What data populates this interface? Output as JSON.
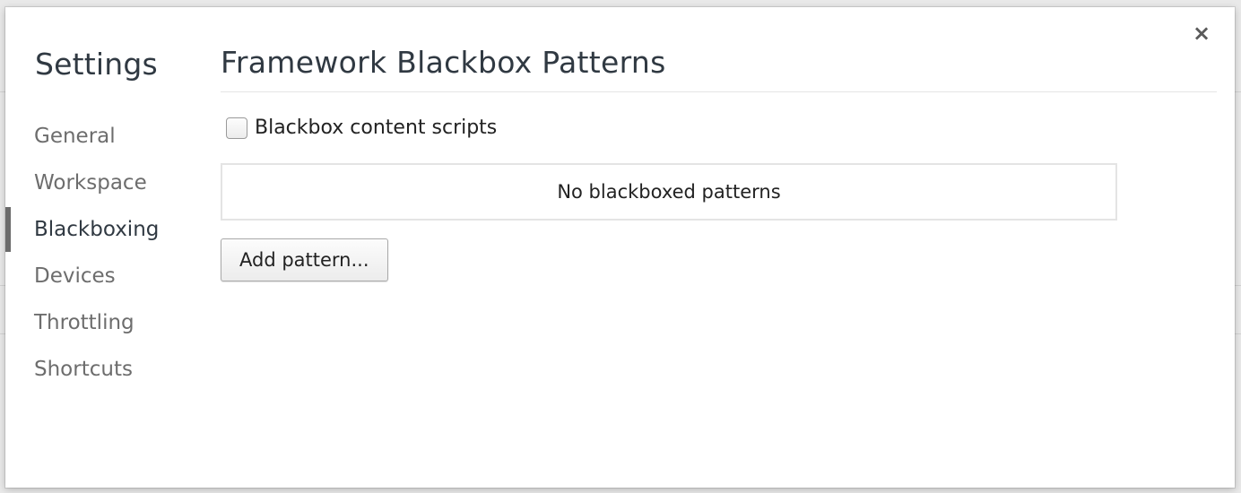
{
  "dialog": {
    "close_glyph": "×"
  },
  "sidebar": {
    "title": "Settings",
    "items": [
      {
        "label": "General"
      },
      {
        "label": "Workspace"
      },
      {
        "label": "Blackboxing"
      },
      {
        "label": "Devices"
      },
      {
        "label": "Throttling"
      },
      {
        "label": "Shortcuts"
      }
    ],
    "selected": "Blackboxing"
  },
  "main": {
    "title": "Framework Blackbox Patterns",
    "checkbox": {
      "label": "Blackbox content scripts",
      "checked": false
    },
    "patterns_list": {
      "empty_text": "No blackboxed patterns"
    },
    "add_button_label": "Add pattern..."
  }
}
